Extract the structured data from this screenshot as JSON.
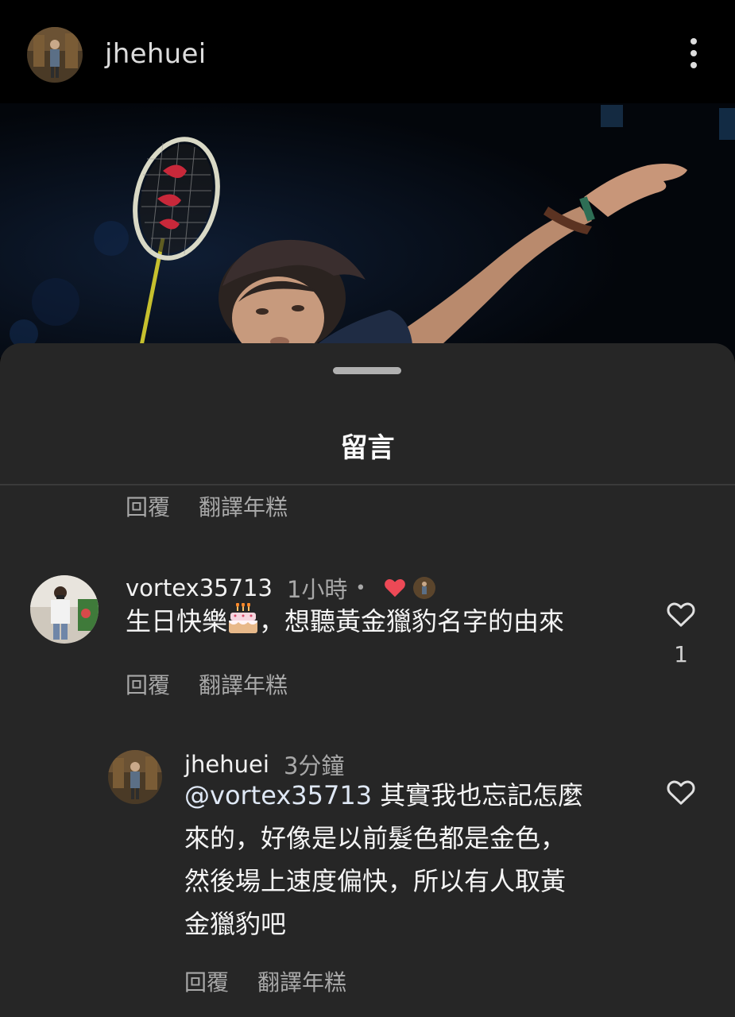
{
  "post": {
    "username": "jhehuei"
  },
  "sheet": {
    "title": "留言"
  },
  "prev_comment": {
    "reply_label": "回覆",
    "translate_label": "翻譯年糕"
  },
  "comments": [
    {
      "username": "vortex35713",
      "time": "1小時",
      "dot": "•",
      "text_before_icon": "生日快樂",
      "icon": "birthday-cake-icon",
      "text_after_icon": "，想聽黃金獵豹名字的由來",
      "reply_label": "回覆",
      "translate_label": "翻譯年糕",
      "like_count": "1"
    }
  ],
  "reply": {
    "username": "jhehuei",
    "time": "3分鐘",
    "mention": "@vortex35713",
    "line1_rest": " 其實我也忘記怎麼",
    "line2": "來的，好像是以前髮色都是金色，",
    "line3": "然後場上速度偏快，所以有人取黃",
    "line4": "金獵豹吧",
    "reply_label": "回覆",
    "translate_label": "翻譯年糕"
  },
  "colors": {
    "background": "#000000",
    "sheet": "#262626",
    "heart_red": "#ed4956",
    "secondary_text": "#a8a8a8"
  }
}
